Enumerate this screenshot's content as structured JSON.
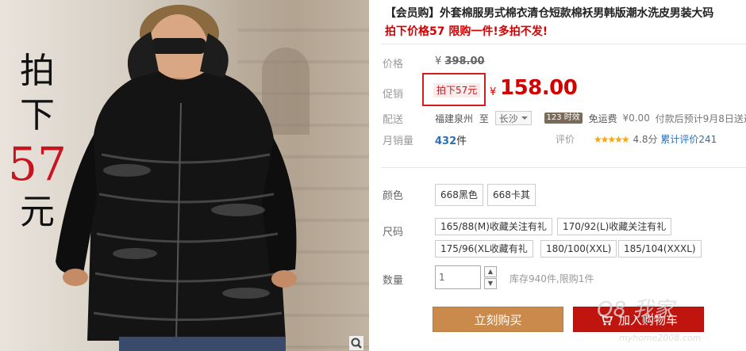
{
  "image": {
    "caption_top": "拍",
    "caption_mid": "下",
    "caption_num": "57",
    "caption_bottom": "元"
  },
  "product": {
    "title": "【会员购】外套棉服男式棉衣清仓短款棉袄男韩版潮水洗皮男装大码",
    "subtitle": "拍下价格57 限购一件!多拍不发!"
  },
  "price": {
    "label": "价格",
    "original_symbol": "¥",
    "original": "398.00",
    "promo_label": "促销",
    "promo_tag": "拍下57元",
    "currency": "¥",
    "current": "158.00"
  },
  "shipping": {
    "label": "配送",
    "from": "福建泉州",
    "to_word": "至",
    "city": "长沙",
    "time_badge": "123 时效",
    "free_ship": "免运费",
    "fee": "¥0.00",
    "eta": "付款后预计9月8日送达"
  },
  "sales": {
    "label": "月销量",
    "count": "432",
    "unit": "件",
    "rating_label": "评价",
    "stars": "★★★★★",
    "score": "4.8分",
    "reviews_link": "累计评价241"
  },
  "color": {
    "label": "颜色",
    "options": [
      "668黑色",
      "668卡其"
    ]
  },
  "size": {
    "label": "尺码",
    "options": [
      "165/88(M)收藏关注有礼",
      "170/92(L)收藏关注有礼",
      "175/96(XL收藏有礼",
      "180/100(XXL)",
      "185/104(XXXL)"
    ]
  },
  "quantity": {
    "label": "数量",
    "value": "1",
    "stock": "库存940件,限购1件"
  },
  "actions": {
    "buy_now": "立刻购买",
    "add_cart": "加入购物车"
  },
  "watermark": {
    "text": "Q8 我家",
    "url": "myhome2008.com"
  },
  "colors": {
    "price_red": "#d40000",
    "buy_orange": "#c98a4c",
    "cart_red": "#c0140f",
    "link_blue": "#2c6fb6"
  }
}
